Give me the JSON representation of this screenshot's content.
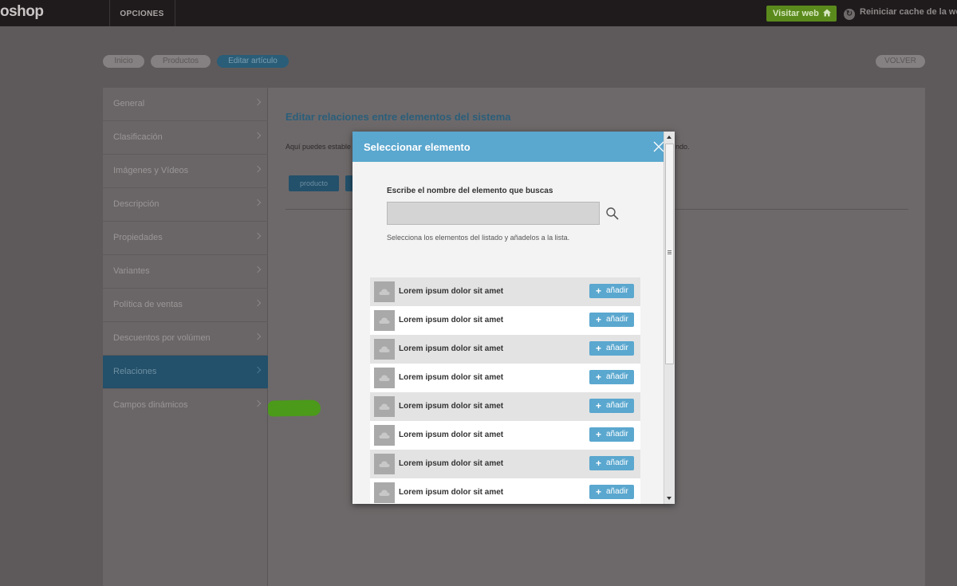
{
  "topbar": {
    "logo": "oshop",
    "nav_item": "OPCIONES",
    "visit_label": "Visitar web",
    "reset_cache_label": "Reiniciar cache de la web",
    "reset_icon": "refresh-icon",
    "colors": {
      "bar": "#1f1b1c",
      "visit": "#5a8a1c"
    }
  },
  "breadcrumb": {
    "items": [
      "Inicio",
      "Productos",
      "Editar artículo"
    ],
    "back": "VOLVER"
  },
  "sidebar": {
    "items": [
      {
        "label": "General"
      },
      {
        "label": "Clasificación"
      },
      {
        "label": "Imágenes y Vídeos"
      },
      {
        "label": "Descripción"
      },
      {
        "label": "Propiedades"
      },
      {
        "label": "Variantes"
      },
      {
        "label": "Política de ventas"
      },
      {
        "label": "Descuentos por volúmen"
      },
      {
        "label": "Relaciones",
        "active": true
      },
      {
        "label": "Campos dinámicos"
      }
    ]
  },
  "main": {
    "title": "Editar relaciones entre elementos del sistema",
    "desc_left": "Aquí puedes estable",
    "desc_right": "ndo.",
    "tag": "producto"
  },
  "modal": {
    "title": "Seleccionar elemento",
    "search_label": "Escribe el nombre del elemento que buscas",
    "search_value": "",
    "search_placeholder": "",
    "help": "Selecciona los elementos del listado y añadelos a la lista.",
    "add_label": "añadir",
    "accent": "#5aa7cf",
    "items": [
      {
        "label": "Lorem ipsum dolor sit amet"
      },
      {
        "label": "Lorem ipsum dolor sit amet"
      },
      {
        "label": "Lorem ipsum dolor sit amet"
      },
      {
        "label": "Lorem ipsum dolor sit amet"
      },
      {
        "label": "Lorem ipsum dolor sit amet"
      },
      {
        "label": "Lorem ipsum dolor sit amet"
      },
      {
        "label": "Lorem ipsum dolor sit amet"
      },
      {
        "label": "Lorem ipsum dolor sit amet"
      }
    ]
  }
}
